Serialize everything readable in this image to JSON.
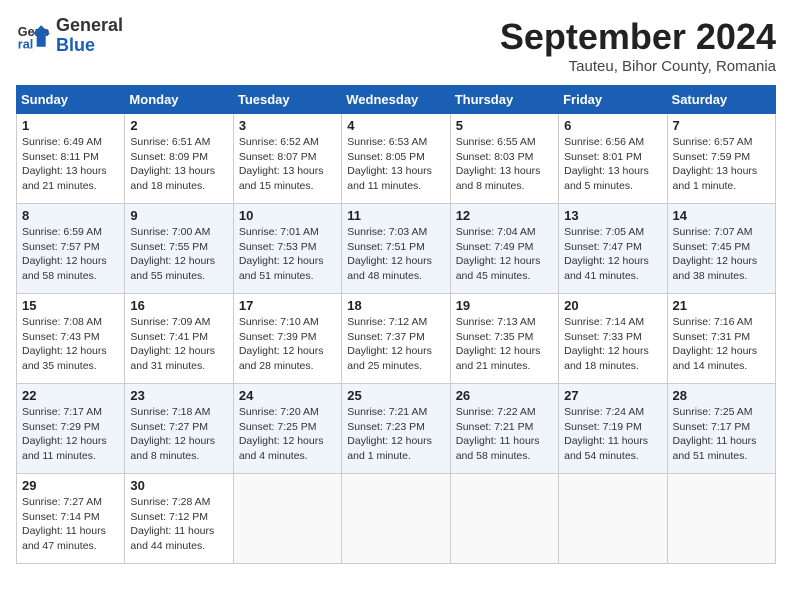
{
  "header": {
    "logo": {
      "general": "General",
      "blue": "Blue"
    },
    "title": "September 2024",
    "subtitle": "Tauteu, Bihor County, Romania"
  },
  "weekdays": [
    "Sunday",
    "Monday",
    "Tuesday",
    "Wednesday",
    "Thursday",
    "Friday",
    "Saturday"
  ],
  "weeks": [
    [
      {
        "day": "1",
        "info": "Sunrise: 6:49 AM\nSunset: 8:11 PM\nDaylight: 13 hours\nand 21 minutes."
      },
      {
        "day": "2",
        "info": "Sunrise: 6:51 AM\nSunset: 8:09 PM\nDaylight: 13 hours\nand 18 minutes."
      },
      {
        "day": "3",
        "info": "Sunrise: 6:52 AM\nSunset: 8:07 PM\nDaylight: 13 hours\nand 15 minutes."
      },
      {
        "day": "4",
        "info": "Sunrise: 6:53 AM\nSunset: 8:05 PM\nDaylight: 13 hours\nand 11 minutes."
      },
      {
        "day": "5",
        "info": "Sunrise: 6:55 AM\nSunset: 8:03 PM\nDaylight: 13 hours\nand 8 minutes."
      },
      {
        "day": "6",
        "info": "Sunrise: 6:56 AM\nSunset: 8:01 PM\nDaylight: 13 hours\nand 5 minutes."
      },
      {
        "day": "7",
        "info": "Sunrise: 6:57 AM\nSunset: 7:59 PM\nDaylight: 13 hours\nand 1 minute."
      }
    ],
    [
      {
        "day": "8",
        "info": "Sunrise: 6:59 AM\nSunset: 7:57 PM\nDaylight: 12 hours\nand 58 minutes."
      },
      {
        "day": "9",
        "info": "Sunrise: 7:00 AM\nSunset: 7:55 PM\nDaylight: 12 hours\nand 55 minutes."
      },
      {
        "day": "10",
        "info": "Sunrise: 7:01 AM\nSunset: 7:53 PM\nDaylight: 12 hours\nand 51 minutes."
      },
      {
        "day": "11",
        "info": "Sunrise: 7:03 AM\nSunset: 7:51 PM\nDaylight: 12 hours\nand 48 minutes."
      },
      {
        "day": "12",
        "info": "Sunrise: 7:04 AM\nSunset: 7:49 PM\nDaylight: 12 hours\nand 45 minutes."
      },
      {
        "day": "13",
        "info": "Sunrise: 7:05 AM\nSunset: 7:47 PM\nDaylight: 12 hours\nand 41 minutes."
      },
      {
        "day": "14",
        "info": "Sunrise: 7:07 AM\nSunset: 7:45 PM\nDaylight: 12 hours\nand 38 minutes."
      }
    ],
    [
      {
        "day": "15",
        "info": "Sunrise: 7:08 AM\nSunset: 7:43 PM\nDaylight: 12 hours\nand 35 minutes."
      },
      {
        "day": "16",
        "info": "Sunrise: 7:09 AM\nSunset: 7:41 PM\nDaylight: 12 hours\nand 31 minutes."
      },
      {
        "day": "17",
        "info": "Sunrise: 7:10 AM\nSunset: 7:39 PM\nDaylight: 12 hours\nand 28 minutes."
      },
      {
        "day": "18",
        "info": "Sunrise: 7:12 AM\nSunset: 7:37 PM\nDaylight: 12 hours\nand 25 minutes."
      },
      {
        "day": "19",
        "info": "Sunrise: 7:13 AM\nSunset: 7:35 PM\nDaylight: 12 hours\nand 21 minutes."
      },
      {
        "day": "20",
        "info": "Sunrise: 7:14 AM\nSunset: 7:33 PM\nDaylight: 12 hours\nand 18 minutes."
      },
      {
        "day": "21",
        "info": "Sunrise: 7:16 AM\nSunset: 7:31 PM\nDaylight: 12 hours\nand 14 minutes."
      }
    ],
    [
      {
        "day": "22",
        "info": "Sunrise: 7:17 AM\nSunset: 7:29 PM\nDaylight: 12 hours\nand 11 minutes."
      },
      {
        "day": "23",
        "info": "Sunrise: 7:18 AM\nSunset: 7:27 PM\nDaylight: 12 hours\nand 8 minutes."
      },
      {
        "day": "24",
        "info": "Sunrise: 7:20 AM\nSunset: 7:25 PM\nDaylight: 12 hours\nand 4 minutes."
      },
      {
        "day": "25",
        "info": "Sunrise: 7:21 AM\nSunset: 7:23 PM\nDaylight: 12 hours\nand 1 minute."
      },
      {
        "day": "26",
        "info": "Sunrise: 7:22 AM\nSunset: 7:21 PM\nDaylight: 11 hours\nand 58 minutes."
      },
      {
        "day": "27",
        "info": "Sunrise: 7:24 AM\nSunset: 7:19 PM\nDaylight: 11 hours\nand 54 minutes."
      },
      {
        "day": "28",
        "info": "Sunrise: 7:25 AM\nSunset: 7:17 PM\nDaylight: 11 hours\nand 51 minutes."
      }
    ],
    [
      {
        "day": "29",
        "info": "Sunrise: 7:27 AM\nSunset: 7:14 PM\nDaylight: 11 hours\nand 47 minutes."
      },
      {
        "day": "30",
        "info": "Sunrise: 7:28 AM\nSunset: 7:12 PM\nDaylight: 11 hours\nand 44 minutes."
      },
      null,
      null,
      null,
      null,
      null
    ]
  ]
}
